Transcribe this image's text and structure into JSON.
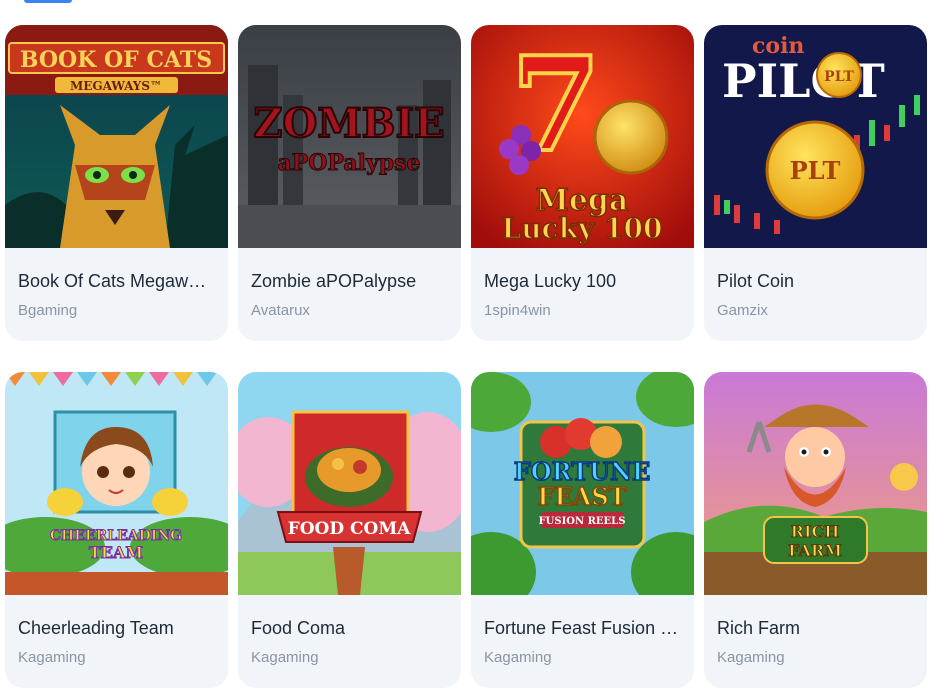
{
  "games": [
    {
      "title": "Book Of Cats Megaways",
      "provider": "Bgaming",
      "art": {
        "line1": "BOOK OF CATS",
        "line2": "MEGAWAYS™"
      }
    },
    {
      "title": "Zombie aPOPalypse",
      "provider": "Avatarux",
      "art": {
        "line1": "ZOMBIE",
        "line2": "aPOPalypse"
      }
    },
    {
      "title": "Mega Lucky 100",
      "provider": "1spin4win",
      "art": {
        "line1": "Mega",
        "line2": "Lucky 100",
        "badge": "7"
      }
    },
    {
      "title": "Pilot Coin",
      "provider": "Gamzix",
      "art": {
        "line1": "coin",
        "line2": "PILOT",
        "badge": "PLT"
      }
    },
    {
      "title": "Cheerleading Team",
      "provider": "Kagaming",
      "art": {
        "line1": "CHEERLEADING",
        "line2": "TEAM"
      }
    },
    {
      "title": "Food Coma",
      "provider": "Kagaming",
      "art": {
        "line1": "FOOD COMA"
      }
    },
    {
      "title": "Fortune Feast Fusion R...",
      "provider": "Kagaming",
      "art": {
        "line1": "FORTUNE",
        "line2": "FEAST",
        "line3": "FUSION REELS"
      }
    },
    {
      "title": "Rich Farm",
      "provider": "Kagaming",
      "art": {
        "line1": "RICH",
        "line2": "FARM"
      }
    }
  ],
  "colors": {
    "card_bg": "#f1f5f9",
    "title": "#1f2937",
    "provider": "#8a94a3",
    "accent": "#3b82f6"
  }
}
